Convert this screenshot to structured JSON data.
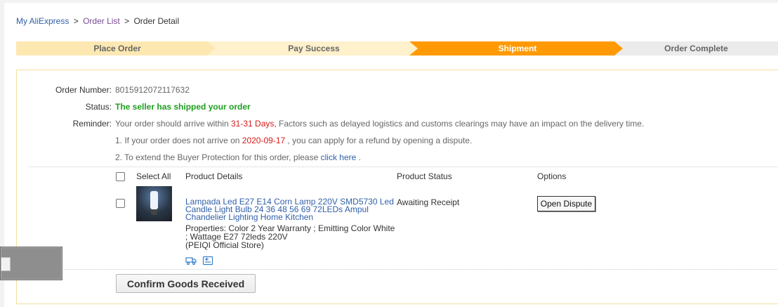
{
  "breadcrumb": {
    "home": "My AliExpress",
    "sep1": ">",
    "list": "Order List",
    "sep2": ">",
    "current": "Order Detail"
  },
  "steps": [
    {
      "label": "Place Order",
      "state": "done"
    },
    {
      "label": "Pay Success",
      "state": "done"
    },
    {
      "label": "Shipment",
      "state": "active"
    },
    {
      "label": "Order Complete",
      "state": "pending"
    }
  ],
  "order": {
    "number_label": "Order Number:",
    "number": "8015912072117632",
    "status_label": "Status:",
    "status": "The seller has shipped your order",
    "reminder_label": "Reminder:",
    "reminder_pre": "Your order should arrive within",
    "reminder_days": "31-31 Days,",
    "reminder_post": "Factors such as delayed logistics and customs clearings may have an impact on the delivery time.",
    "note1_pre": "1. If your order does not arrive on",
    "note1_date": "2020-09-17",
    "note1_post": ", you can apply for a refund by opening a dispute.",
    "note2_pre": "2. To extend the Buyer Protection for this order, please",
    "note2_link": "click here",
    "note2_post": "."
  },
  "table": {
    "select_all": "Select All",
    "col_product": "Product Details",
    "col_status": "Product Status",
    "col_options": "Options"
  },
  "product": {
    "title": "Lampada Led E27 E14 Corn Lamp 220V SMD5730 Led Candle Light Bulb 24 36 48 56 69 72LEDs Ampul Chandelier Lighting Home Kitchen",
    "properties": "Properties: Color 2 Year Warranty   ; Emitting Color White   ; Wattage E27 72leds 220V",
    "store": "(PEIQI Official Store)",
    "status": "Awaiting Receipt",
    "option_button": "Open Dispute"
  },
  "actions": {
    "confirm": "Confirm Goods Received"
  },
  "colors": {
    "active_step": "#ff9a05",
    "status_green": "#1e9e1e",
    "link_blue": "#2f5fa8",
    "alert_red": "#d61a1a"
  }
}
